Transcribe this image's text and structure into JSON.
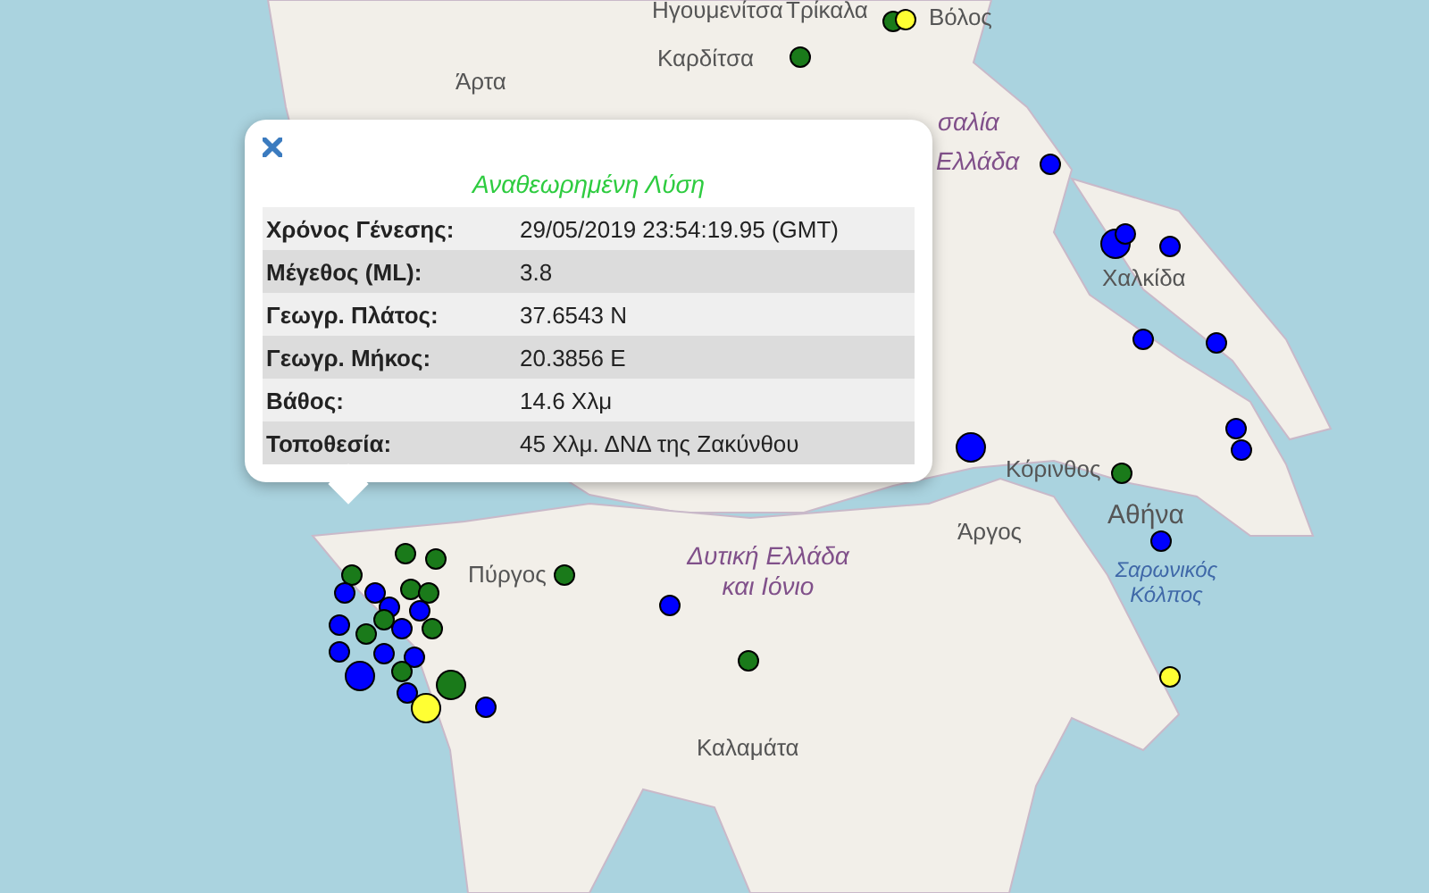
{
  "map_labels": [
    {
      "text": "Ηγουμενίτσα",
      "kind": "city"
    },
    {
      "text": "Τρίκαλα",
      "kind": "city"
    },
    {
      "text": "Βόλος",
      "kind": "city"
    },
    {
      "text": "Άρτα",
      "kind": "city"
    },
    {
      "text": "Καρδίτσα",
      "kind": "city"
    },
    {
      "text": "σαλία",
      "kind": "region"
    },
    {
      "text": "Ελλάδα",
      "kind": "region"
    },
    {
      "text": "Χαλκίδα",
      "kind": "city"
    },
    {
      "text": "Κόρινθος",
      "kind": "city"
    },
    {
      "text": "Αθήνα",
      "kind": "capital"
    },
    {
      "text": "Πύργος",
      "kind": "city"
    },
    {
      "text": "Δυτική Ελλάδα και Ιόνιο",
      "kind": "region"
    },
    {
      "text": "Άργος",
      "kind": "city"
    },
    {
      "text": "Σαρωνικός Κόλπος",
      "kind": "sea"
    },
    {
      "text": "Καλαμάτα",
      "kind": "city"
    }
  ],
  "earthquakes": [
    {
      "color": "#1a7a1a",
      "kind": "small"
    },
    {
      "color": "#ffff33",
      "kind": "small"
    },
    {
      "color": "#1a7a1a",
      "kind": "small"
    },
    {
      "color": "#0000ff",
      "kind": "small"
    },
    {
      "color": "#0000ff",
      "kind": "large"
    },
    {
      "color": "#0000ff",
      "kind": "small"
    },
    {
      "color": "#0000ff",
      "kind": "small"
    },
    {
      "color": "#0000ff",
      "kind": "small"
    },
    {
      "color": "#0000ff",
      "kind": "small"
    },
    {
      "color": "#0000ff",
      "kind": "small"
    },
    {
      "color": "#0000ff",
      "kind": "small"
    },
    {
      "color": "#0000ff",
      "kind": "large"
    },
    {
      "color": "#1a7a1a",
      "kind": "small"
    },
    {
      "color": "#0000ff",
      "kind": "small"
    },
    {
      "color": "#ffff33",
      "kind": "small"
    },
    {
      "color": "#1a7a1a",
      "kind": "small"
    },
    {
      "color": "#0000ff",
      "kind": "small"
    },
    {
      "color": "#1a7a1a",
      "kind": "small"
    },
    {
      "color": "#1a7a1a",
      "kind": "small"
    },
    {
      "color": "#0000ff",
      "kind": "small"
    },
    {
      "color": "#0000ff",
      "kind": "small"
    },
    {
      "color": "#1a7a1a",
      "kind": "small"
    },
    {
      "color": "#1a7a1a",
      "kind": "small"
    },
    {
      "color": "#1a7a1a",
      "kind": "small"
    },
    {
      "color": "#1a7a1a",
      "kind": "small"
    },
    {
      "color": "#0000ff",
      "kind": "small"
    },
    {
      "color": "#0000ff",
      "kind": "small"
    },
    {
      "color": "#0000ff",
      "kind": "small"
    },
    {
      "color": "#1a7a1a",
      "kind": "small"
    },
    {
      "color": "#1a7a1a",
      "kind": "small"
    },
    {
      "color": "#0000ff",
      "kind": "small"
    },
    {
      "color": "#1a7a1a",
      "kind": "small"
    },
    {
      "color": "#0000ff",
      "kind": "small"
    },
    {
      "color": "#0000ff",
      "kind": "small"
    },
    {
      "color": "#0000ff",
      "kind": "small"
    },
    {
      "color": "#1a7a1a",
      "kind": "large"
    },
    {
      "color": "#ffff33",
      "kind": "large"
    },
    {
      "color": "#0000ff",
      "kind": "large"
    },
    {
      "color": "#0000ff",
      "kind": "small"
    },
    {
      "color": "#0000ff",
      "kind": "small"
    },
    {
      "color": "#1a7a1a",
      "kind": "small"
    }
  ],
  "popup": {
    "title": "Αναθεωρημένη Λύση",
    "rows": [
      {
        "label": "Χρόνος Γένεσης:",
        "value": "29/05/2019 23:54:19.95 (GMT)"
      },
      {
        "label": "Μέγεθος (ML):",
        "value": "3.8"
      },
      {
        "label": "Γεωγρ. Πλάτος:",
        "value": "37.6543 N"
      },
      {
        "label": "Γεωγρ. Μήκος:",
        "value": "20.3856 E"
      },
      {
        "label": "Βάθος:",
        "value": "14.6 Χλμ"
      },
      {
        "label": "Τοποθεσία:",
        "value": "45 Χλμ. ΔΝΔ της Ζακύνθου"
      }
    ]
  }
}
